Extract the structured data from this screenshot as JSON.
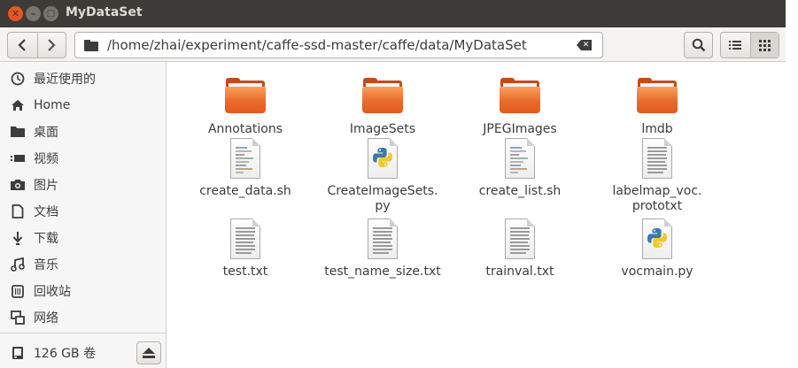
{
  "window": {
    "title": "MyDataSet",
    "close_glyph": "✕",
    "min_glyph": "–",
    "max_glyph": "□"
  },
  "toolbar": {
    "back_glyph": "‹",
    "forward_glyph": "›",
    "path": "/home/zhai/experiment/caffe-ssd-master/caffe/data/MyDataSet"
  },
  "sidebar": {
    "items": [
      {
        "label": "最近使用的",
        "icon": "clock-icon"
      },
      {
        "label": "Home",
        "icon": "home-icon"
      },
      {
        "label": "桌面",
        "icon": "desktop-folder-icon"
      },
      {
        "label": "视频",
        "icon": "video-icon"
      },
      {
        "label": "图片",
        "icon": "camera-icon"
      },
      {
        "label": "文档",
        "icon": "document-icon"
      },
      {
        "label": "下载",
        "icon": "download-icon"
      },
      {
        "label": "音乐",
        "icon": "music-icon"
      },
      {
        "label": "回收站",
        "icon": "trash-icon"
      },
      {
        "label": "网络",
        "icon": "network-icon"
      }
    ],
    "volume": {
      "label": "126 GB 卷",
      "icon": "drive-icon",
      "eject_icon": "eject-icon"
    }
  },
  "files": [
    {
      "name": "Annotations",
      "type": "folder"
    },
    {
      "name": "ImageSets",
      "type": "folder"
    },
    {
      "name": "JPEGImages",
      "type": "folder"
    },
    {
      "name": "lmdb",
      "type": "folder"
    },
    {
      "name": "create_data.sh",
      "type": "script"
    },
    {
      "name": "CreateImageSets.\npy",
      "type": "python"
    },
    {
      "name": "create_list.sh",
      "type": "script"
    },
    {
      "name": "labelmap_voc.\nprototxt",
      "type": "text"
    },
    {
      "name": "test.txt",
      "type": "text"
    },
    {
      "name": "test_name_size.txt",
      "type": "text"
    },
    {
      "name": "trainval.txt",
      "type": "text"
    },
    {
      "name": "vocmain.py",
      "type": "python"
    }
  ],
  "colors": {
    "titlebar": "#3c3b37",
    "close": "#e95420",
    "folder": "#ea6b2a"
  }
}
